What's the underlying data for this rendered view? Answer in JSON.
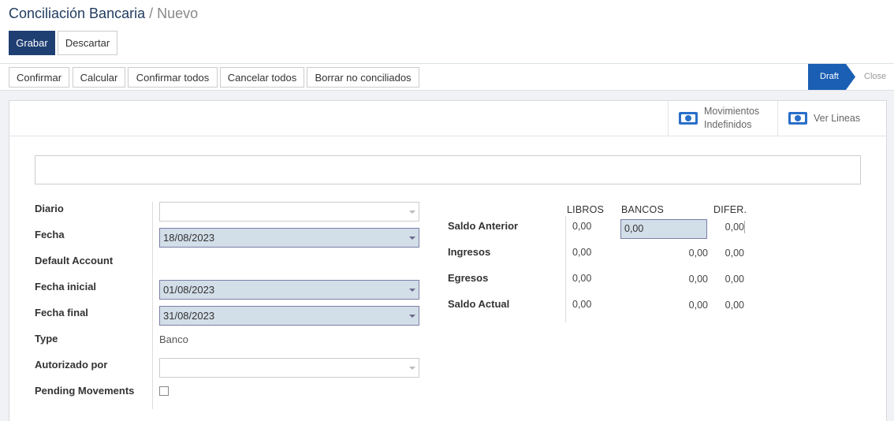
{
  "breadcrumb": {
    "main": "Conciliación Bancaria",
    "separator": "/",
    "current": "Nuevo"
  },
  "actions": {
    "save_label": "Grabar",
    "discard_label": "Descartar"
  },
  "header_buttons": [
    "Confirmar",
    "Calcular",
    "Confirmar todos",
    "Cancelar todos",
    "Borrar no conciliados"
  ],
  "status": {
    "active": "Draft",
    "inactive": "Close",
    "active_color": "#1a5fb4"
  },
  "smart_buttons": {
    "movimientos": {
      "line1": "Movimientos",
      "line2": "Indefinidos",
      "icon": "money-icon"
    },
    "lineas": {
      "label": "Ver Lineas",
      "icon": "money-icon"
    }
  },
  "name_field": {
    "value": "",
    "placeholder": ""
  },
  "fields": {
    "diario": {
      "label": "Diario",
      "value": ""
    },
    "fecha": {
      "label": "Fecha",
      "value": "18/08/2023"
    },
    "default_account": {
      "label": "Default Account",
      "value": ""
    },
    "fecha_inicial": {
      "label": "Fecha inicial",
      "value": "01/08/2023"
    },
    "fecha_final": {
      "label": "Fecha final",
      "value": "31/08/2023"
    },
    "type": {
      "label": "Type",
      "value": "Banco"
    },
    "autorizado_por": {
      "label": "Autorizado por",
      "value": ""
    },
    "pending_movements": {
      "label": "Pending Movements",
      "checked": false
    }
  },
  "balance": {
    "columns": {
      "libros": "LIBROS",
      "bancos": "BANCOS",
      "difer": "DIFER."
    },
    "rows": [
      {
        "label": "Saldo Anterior",
        "libros": "0,00",
        "bancos": "0,00",
        "difer": "0,00"
      },
      {
        "label": "Ingresos",
        "libros": "0,00",
        "bancos": "0,00",
        "difer": "0,00"
      },
      {
        "label": "Egresos",
        "libros": "0,00",
        "bancos": "0,00",
        "difer": "0,00"
      },
      {
        "label": "Saldo Actual",
        "libros": "0,00",
        "bancos": "0,00",
        "difer": "0,00"
      }
    ]
  }
}
